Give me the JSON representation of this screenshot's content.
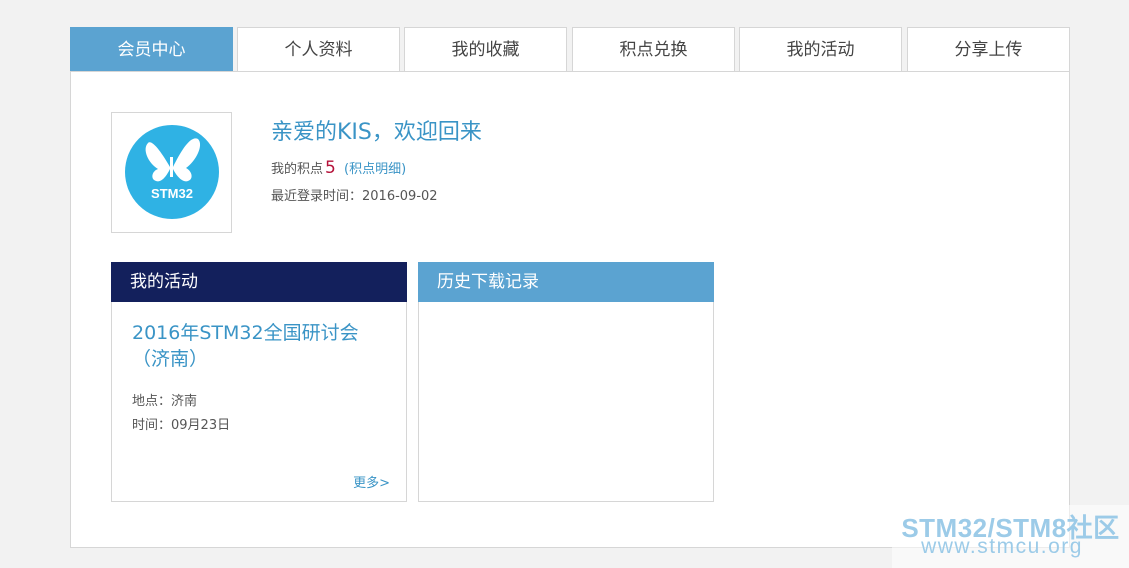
{
  "tabs": [
    {
      "label": "会员中心",
      "active": true
    },
    {
      "label": "个人资料",
      "active": false
    },
    {
      "label": "我的收藏",
      "active": false
    },
    {
      "label": "积点兑换",
      "active": false
    },
    {
      "label": "我的活动",
      "active": false
    },
    {
      "label": "分享上传",
      "active": false
    }
  ],
  "profile": {
    "avatar_icon": "stm32-butterfly-logo",
    "avatar_text": "STM32",
    "welcome": "亲爱的KIS，欢迎回来",
    "points_label": "我的积点",
    "points_value": "5",
    "points_detail_open": "(",
    "points_detail": "积点明细",
    "points_detail_close": ")",
    "last_login": "最近登录时间：2016-09-02"
  },
  "activity_card": {
    "header": "我的活动",
    "event_title": "2016年STM32全国研讨会（济南）",
    "location": "地点：济南",
    "time": "时间：09月23日",
    "more": "更多>"
  },
  "history_card": {
    "header": "历史下载记录"
  },
  "watermark": {
    "title": "STM32/STM8社区",
    "url": "www.stmcu.org"
  },
  "colors": {
    "accent": "#5ba3d1",
    "navy": "#13205c",
    "link": "#3a94c6",
    "points": "#b5123a",
    "logo_bg": "#2fb2e4"
  }
}
